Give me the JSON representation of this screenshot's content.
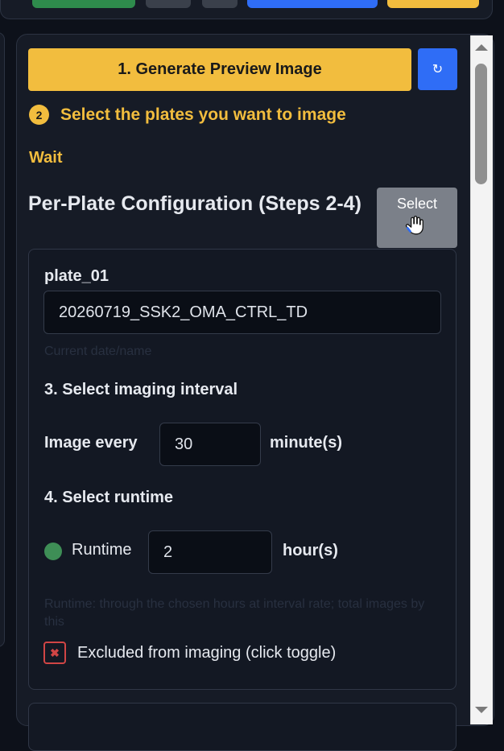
{
  "colors": {
    "background": "#0d111a",
    "panel": "#161b26",
    "accent_yellow": "#f2bd3e",
    "accent_blue": "#2f6df6",
    "accent_green": "#2e8b4c",
    "status_green": "#3e8e56",
    "danger_red": "#d04545"
  },
  "actions": {
    "generate_label": "1. Generate Preview Image",
    "refresh_icon": "refresh-icon",
    "refresh_glyph": "↻"
  },
  "step2": {
    "number": "2",
    "text": "Select the plates you want to image"
  },
  "status_text": "Wait",
  "config": {
    "title": "Per-Plate Configuration (Steps 2-4)",
    "select_button": "Select",
    "cursor_icon": "hand-pointer-icon"
  },
  "plate": {
    "name": "plate_01",
    "experiment_value": "20260719_SSK2_OMA_CTRL_TD",
    "faint_caption": "Current date/name",
    "interval_heading": "3. Select imaging interval",
    "interval_prefix": "Image every",
    "interval_value": "30",
    "interval_unit": "minute(s)",
    "runtime_heading": "4. Select runtime",
    "runtime_label": "Runtime",
    "runtime_value": "2",
    "runtime_unit": "hour(s)",
    "faint_note": "Runtime: through the chosen hours at interval rate; total images by this",
    "exclude_icon": "close-icon",
    "exclude_glyph": "✖",
    "exclude_label": "Excluded from imaging (click toggle)"
  }
}
